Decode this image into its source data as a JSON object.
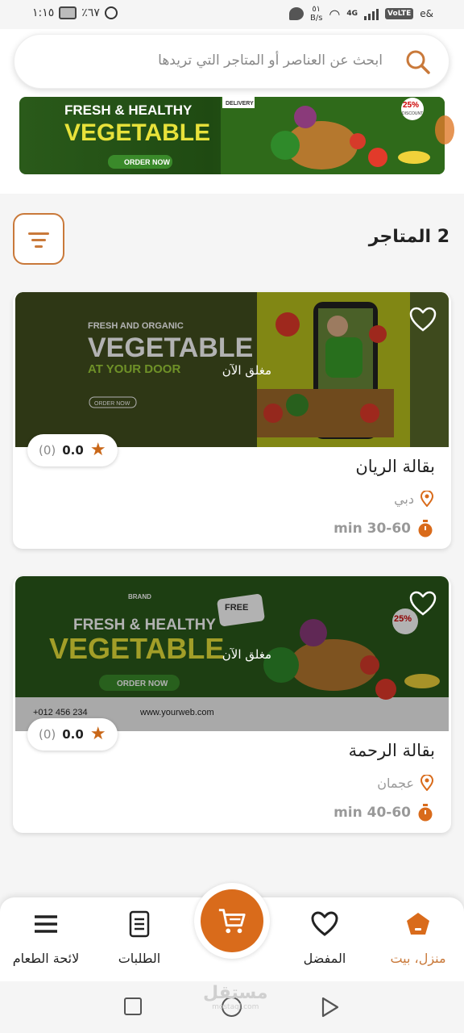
{
  "status_bar": {
    "time": "١:١٥",
    "battery": "٪٦٧",
    "net_speed_value": "٥١",
    "net_speed_unit": "B/s",
    "network": "4G",
    "volte": "VoLTE",
    "extra": "e&"
  },
  "search": {
    "placeholder": "ابحث عن العناصر أو المتاجر التي تريدها"
  },
  "stores_header": {
    "title": "2 المتاجر"
  },
  "stores": [
    {
      "name": "بقالة الريان",
      "status": "مغلق الآن",
      "location": "دبي",
      "delivery_time": "min 30-60",
      "rating": "0.0",
      "rating_count": "(0)"
    },
    {
      "name": "بقالة الرحمة",
      "status": "مغلق الآن",
      "location": "عجمان",
      "delivery_time": "min 40-60",
      "rating": "0.0",
      "rating_count": "(0)"
    }
  ],
  "bottom_nav": {
    "home": "منزل، بيت",
    "favorites": "المفضل",
    "orders": "الطلبات",
    "menu": "لائحة الطعام"
  },
  "watermark": {
    "text": "مستقل",
    "sub": "mostaql.com"
  },
  "colors": {
    "accent": "#c9793a",
    "cart": "#d96b1b",
    "star": "#c96718"
  }
}
